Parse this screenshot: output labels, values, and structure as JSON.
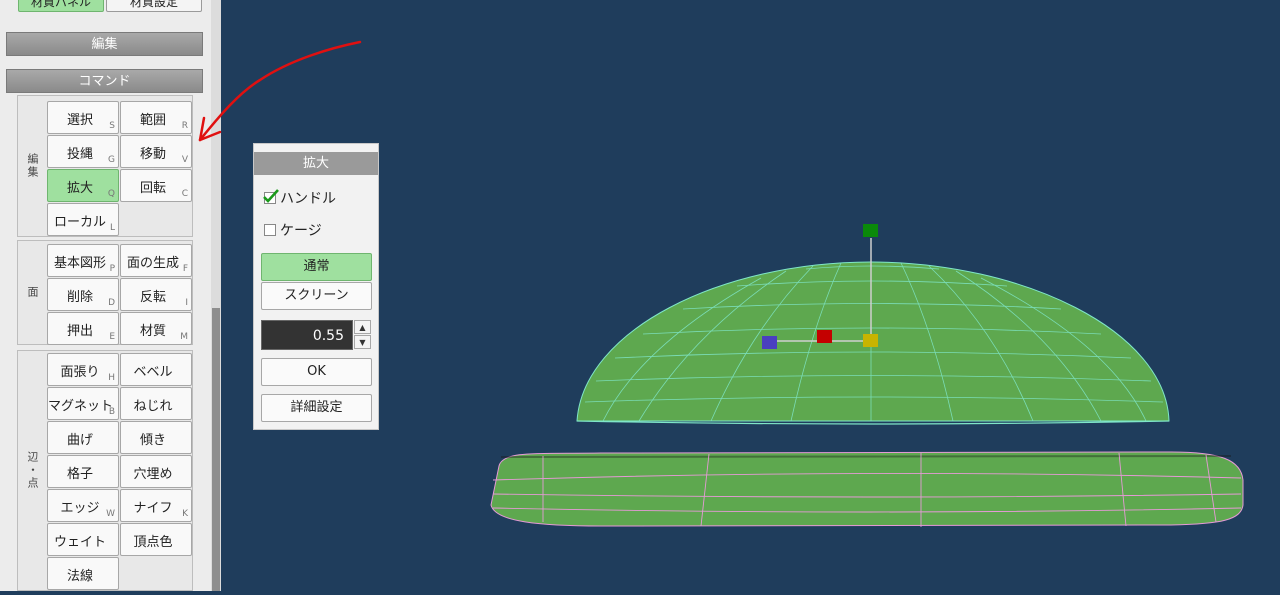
{
  "top_tabs": {
    "left": "材質パネル",
    "right": "材質設定"
  },
  "sections": {
    "edit": "編集",
    "command": "コマンド"
  },
  "groups": {
    "edit": {
      "label": "編集",
      "commands": [
        {
          "label": "選択",
          "shortcut": "S"
        },
        {
          "label": "範囲",
          "shortcut": "R"
        },
        {
          "label": "投縄",
          "shortcut": "G"
        },
        {
          "label": "移動",
          "shortcut": "V"
        },
        {
          "label": "拡大",
          "shortcut": "Q"
        },
        {
          "label": "回転",
          "shortcut": "C"
        },
        {
          "label": "ローカル",
          "shortcut": "L"
        }
      ]
    },
    "face": {
      "label": "面",
      "commands": [
        {
          "label": "基本図形",
          "shortcut": "P"
        },
        {
          "label": "面の生成",
          "shortcut": "F"
        },
        {
          "label": "削除",
          "shortcut": "D"
        },
        {
          "label": "反転",
          "shortcut": "I"
        },
        {
          "label": "押出",
          "shortcut": "E"
        },
        {
          "label": "材質",
          "shortcut": "M"
        }
      ]
    },
    "edge": {
      "label": "辺・点",
      "commands": [
        {
          "label": "面張り",
          "shortcut": "H"
        },
        {
          "label": "ベベル",
          "shortcut": ""
        },
        {
          "label": "マグネット",
          "shortcut": "B"
        },
        {
          "label": "ねじれ",
          "shortcut": ""
        },
        {
          "label": "曲げ",
          "shortcut": ""
        },
        {
          "label": "傾き",
          "shortcut": ""
        },
        {
          "label": "格子",
          "shortcut": ""
        },
        {
          "label": "穴埋め",
          "shortcut": ""
        },
        {
          "label": "エッジ",
          "shortcut": "W"
        },
        {
          "label": "ナイフ",
          "shortcut": "K"
        },
        {
          "label": "ウェイト",
          "shortcut": ""
        },
        {
          "label": "頂点色",
          "shortcut": ""
        },
        {
          "label": "法線",
          "shortcut": ""
        }
      ]
    }
  },
  "dialog": {
    "title": "拡大",
    "handle_label": "ハンドル",
    "handle_checked": true,
    "cage_label": "ケージ",
    "cage_checked": false,
    "normal_label": "通常",
    "screen_label": "スクリーン",
    "value": "0.55",
    "ok_label": "OK",
    "detail_label": "詳細設定"
  },
  "colors": {
    "viewport_bg": "#1f3d5c",
    "mesh_fill": "#5ea84f",
    "dome_wire": "#7fe6c8",
    "disc_wire": "#e59ad6",
    "handle_green": "#0a8a0a",
    "handle_red": "#c40000",
    "handle_blue": "#4a3fc0",
    "handle_yellow": "#c8b400",
    "annotation": "#e01010"
  }
}
